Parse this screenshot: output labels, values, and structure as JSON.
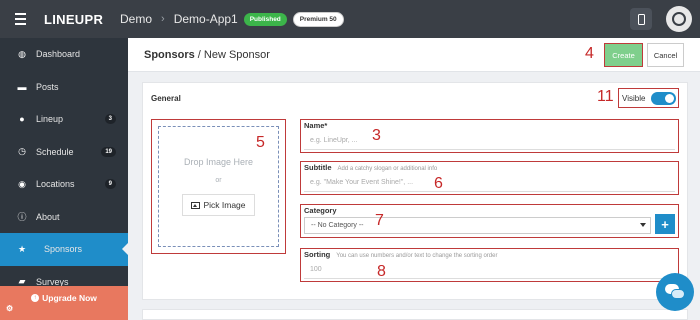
{
  "topbar": {
    "brand": "LINEUPR",
    "crumb_app_group": "Demo",
    "crumb_app": "Demo-App1",
    "status_badge": "Published",
    "plan_badge": "Premium 50",
    "icons": [
      "menu-icon",
      "phone-icon",
      "user-avatar"
    ]
  },
  "sidebar": {
    "items": [
      {
        "label": "Dashboard",
        "icon": "◍",
        "badge": ""
      },
      {
        "label": "Posts",
        "icon": "▬",
        "badge": ""
      },
      {
        "label": "Lineup",
        "icon": "●",
        "badge": "3"
      },
      {
        "label": "Schedule",
        "icon": "◷",
        "badge": "19"
      },
      {
        "label": "Locations",
        "icon": "◉",
        "badge": "9"
      },
      {
        "label": "About",
        "icon": "ⓘ",
        "badge": ""
      },
      {
        "label": "Sponsors",
        "icon": "★",
        "badge": ""
      },
      {
        "label": "Surveys",
        "icon": "▰",
        "badge": ""
      }
    ],
    "active": "Sponsors",
    "upgrade_label": "Upgrade Now"
  },
  "header": {
    "title_bold": "Sponsors",
    "title_rest": " / New Sponsor",
    "create_label": "Create",
    "cancel_label": "Cancel"
  },
  "form": {
    "section_title": "General",
    "visible_label": "Visible",
    "visible_on": true,
    "image": {
      "drop_text": "Drop Image Here",
      "or_text": "or",
      "pick_label": "Pick Image"
    },
    "name": {
      "label": "Name*",
      "placeholder": "e.g. LineUpr, ..."
    },
    "subtitle": {
      "label": "Subtitle",
      "hint": "Add a catchy slogan or additional info",
      "placeholder": "e.g. \"Make Your Event Shine!\", ..."
    },
    "category": {
      "label": "Category",
      "selected": "-- No Category --"
    },
    "sorting": {
      "label": "Sorting",
      "hint": "You can use numbers and/or text to change the sorting order",
      "placeholder": "100"
    }
  },
  "annotations": {
    "create": "4",
    "image": "5",
    "name": "3",
    "subtitle": "6",
    "category": "7",
    "sorting": "8",
    "visible": "11"
  },
  "colors": {
    "accent": "#1f8dc9",
    "sidebar": "#2e353d",
    "topbar": "#3a3f46",
    "upgrade": "#e8785f",
    "annotation": "#c62828",
    "published": "#3cb54a"
  }
}
